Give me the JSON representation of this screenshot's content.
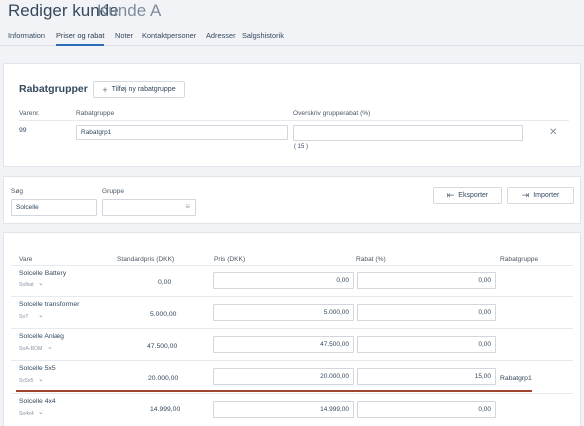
{
  "header": {
    "title": "Rediger kunde",
    "subtitle": "Kunde A"
  },
  "tabs": [
    {
      "label": "Information"
    },
    {
      "label": "Priser og rabat"
    },
    {
      "label": "Noter"
    },
    {
      "label": "Kontaktpersoner"
    },
    {
      "label": "Adresser"
    },
    {
      "label": "Salgshistorik"
    }
  ],
  "rabatgrupper": {
    "title": "Rabatgrupper",
    "add_button": "Tilføj ny rabatgruppe",
    "col_varenr": "Varenr.",
    "col_rabatgruppe": "Rabatgruppe",
    "col_overskriv": "Overskriv grupperabat (%)",
    "row": {
      "varenr": "99",
      "rabatgruppe": "Rabatgrp1",
      "overskriv": "",
      "hint": "( 15 )"
    }
  },
  "filter": {
    "search_label": "Søg",
    "search_value": "Solcelle",
    "group_label": "Gruppe",
    "group_value": "",
    "export_label": "Eksporter",
    "import_label": "Importer"
  },
  "table": {
    "headers": {
      "vare": "Vare",
      "standardpris": "Standardpris (DKK)",
      "pris": "Pris (DKK)",
      "rabat": "Rabat (%)",
      "rabatgruppe": "Rabatgruppe"
    },
    "rows": [
      {
        "name": "Solcelle Battery",
        "code": "Solbat",
        "standardpris": "0,00",
        "pris": "0,00",
        "rabat": "0,00",
        "rabatgruppe": ""
      },
      {
        "name": "Solcelle transformer",
        "code": "SoT",
        "standardpris": "5.000,00",
        "pris": "5.000,00",
        "rabat": "0,00",
        "rabatgruppe": ""
      },
      {
        "name": "Solcelle Anlæg",
        "code": "SoA-BOM",
        "standardpris": "47.500,00",
        "pris": "47.500,00",
        "rabat": "0,00",
        "rabatgruppe": ""
      },
      {
        "name": "Solcelle 5x5",
        "code": "Sc5x5",
        "standardpris": "20.000,00",
        "pris": "20.000,00",
        "rabat": "15,00",
        "rabatgruppe": "Rabatgrp1"
      },
      {
        "name": "Solcelle 4x4",
        "code": "So4x4",
        "standardpris": "14.999,00",
        "pris": "14.999,00",
        "rabat": "0,00",
        "rabatgruppe": ""
      }
    ]
  },
  "colors": {
    "accent": "#2c6fb7",
    "highlight": "#a04630"
  }
}
